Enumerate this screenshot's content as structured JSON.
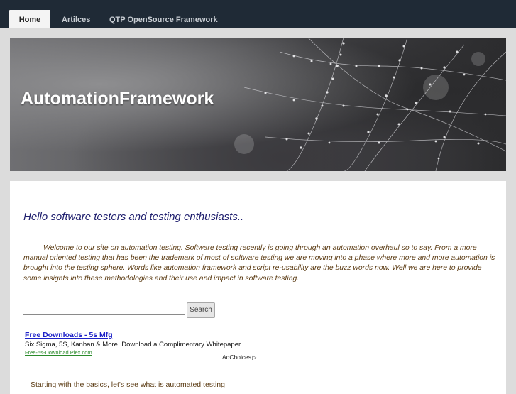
{
  "nav": {
    "tabs": [
      {
        "label": "Home",
        "active": true
      },
      {
        "label": "Artilces",
        "active": false
      },
      {
        "label": "QTP OpenSource Framework",
        "active": false
      }
    ]
  },
  "banner": {
    "title": "AutomationFramework"
  },
  "main": {
    "headline": "Hello software testers and testing enthusiasts..",
    "intro": "Welcome to our site on automation testing. Software testing recently is going through an automation overhaul so to say. From a more manual oriented testing that has been the trademark of most of software testing we are moving into a phase where more and more automation is brought into the testing sphere. Words like automation framework and script re-usability are the buzz words now. Well we are here to provide some insights into these methodologies and their use and impact in software testing.",
    "search": {
      "value": "",
      "button_label": "Search"
    },
    "ad": {
      "title": "Free Downloads - 5s Mfg",
      "description": "Six Sigma, 5S, Kanban & More. Download a Complimentary Whitepaper",
      "url": "Free-5s-Download.Plex.com",
      "adchoices_label": "AdChoices"
    },
    "bottom_text": "Starting with the basics, let's see what is automated testing"
  },
  "colors": {
    "topbar": "#1f2a36",
    "headline": "#1f1f6e",
    "body_text": "#5a3a12",
    "ad_link": "#1d22c8",
    "ad_url": "#2a8a2a"
  }
}
